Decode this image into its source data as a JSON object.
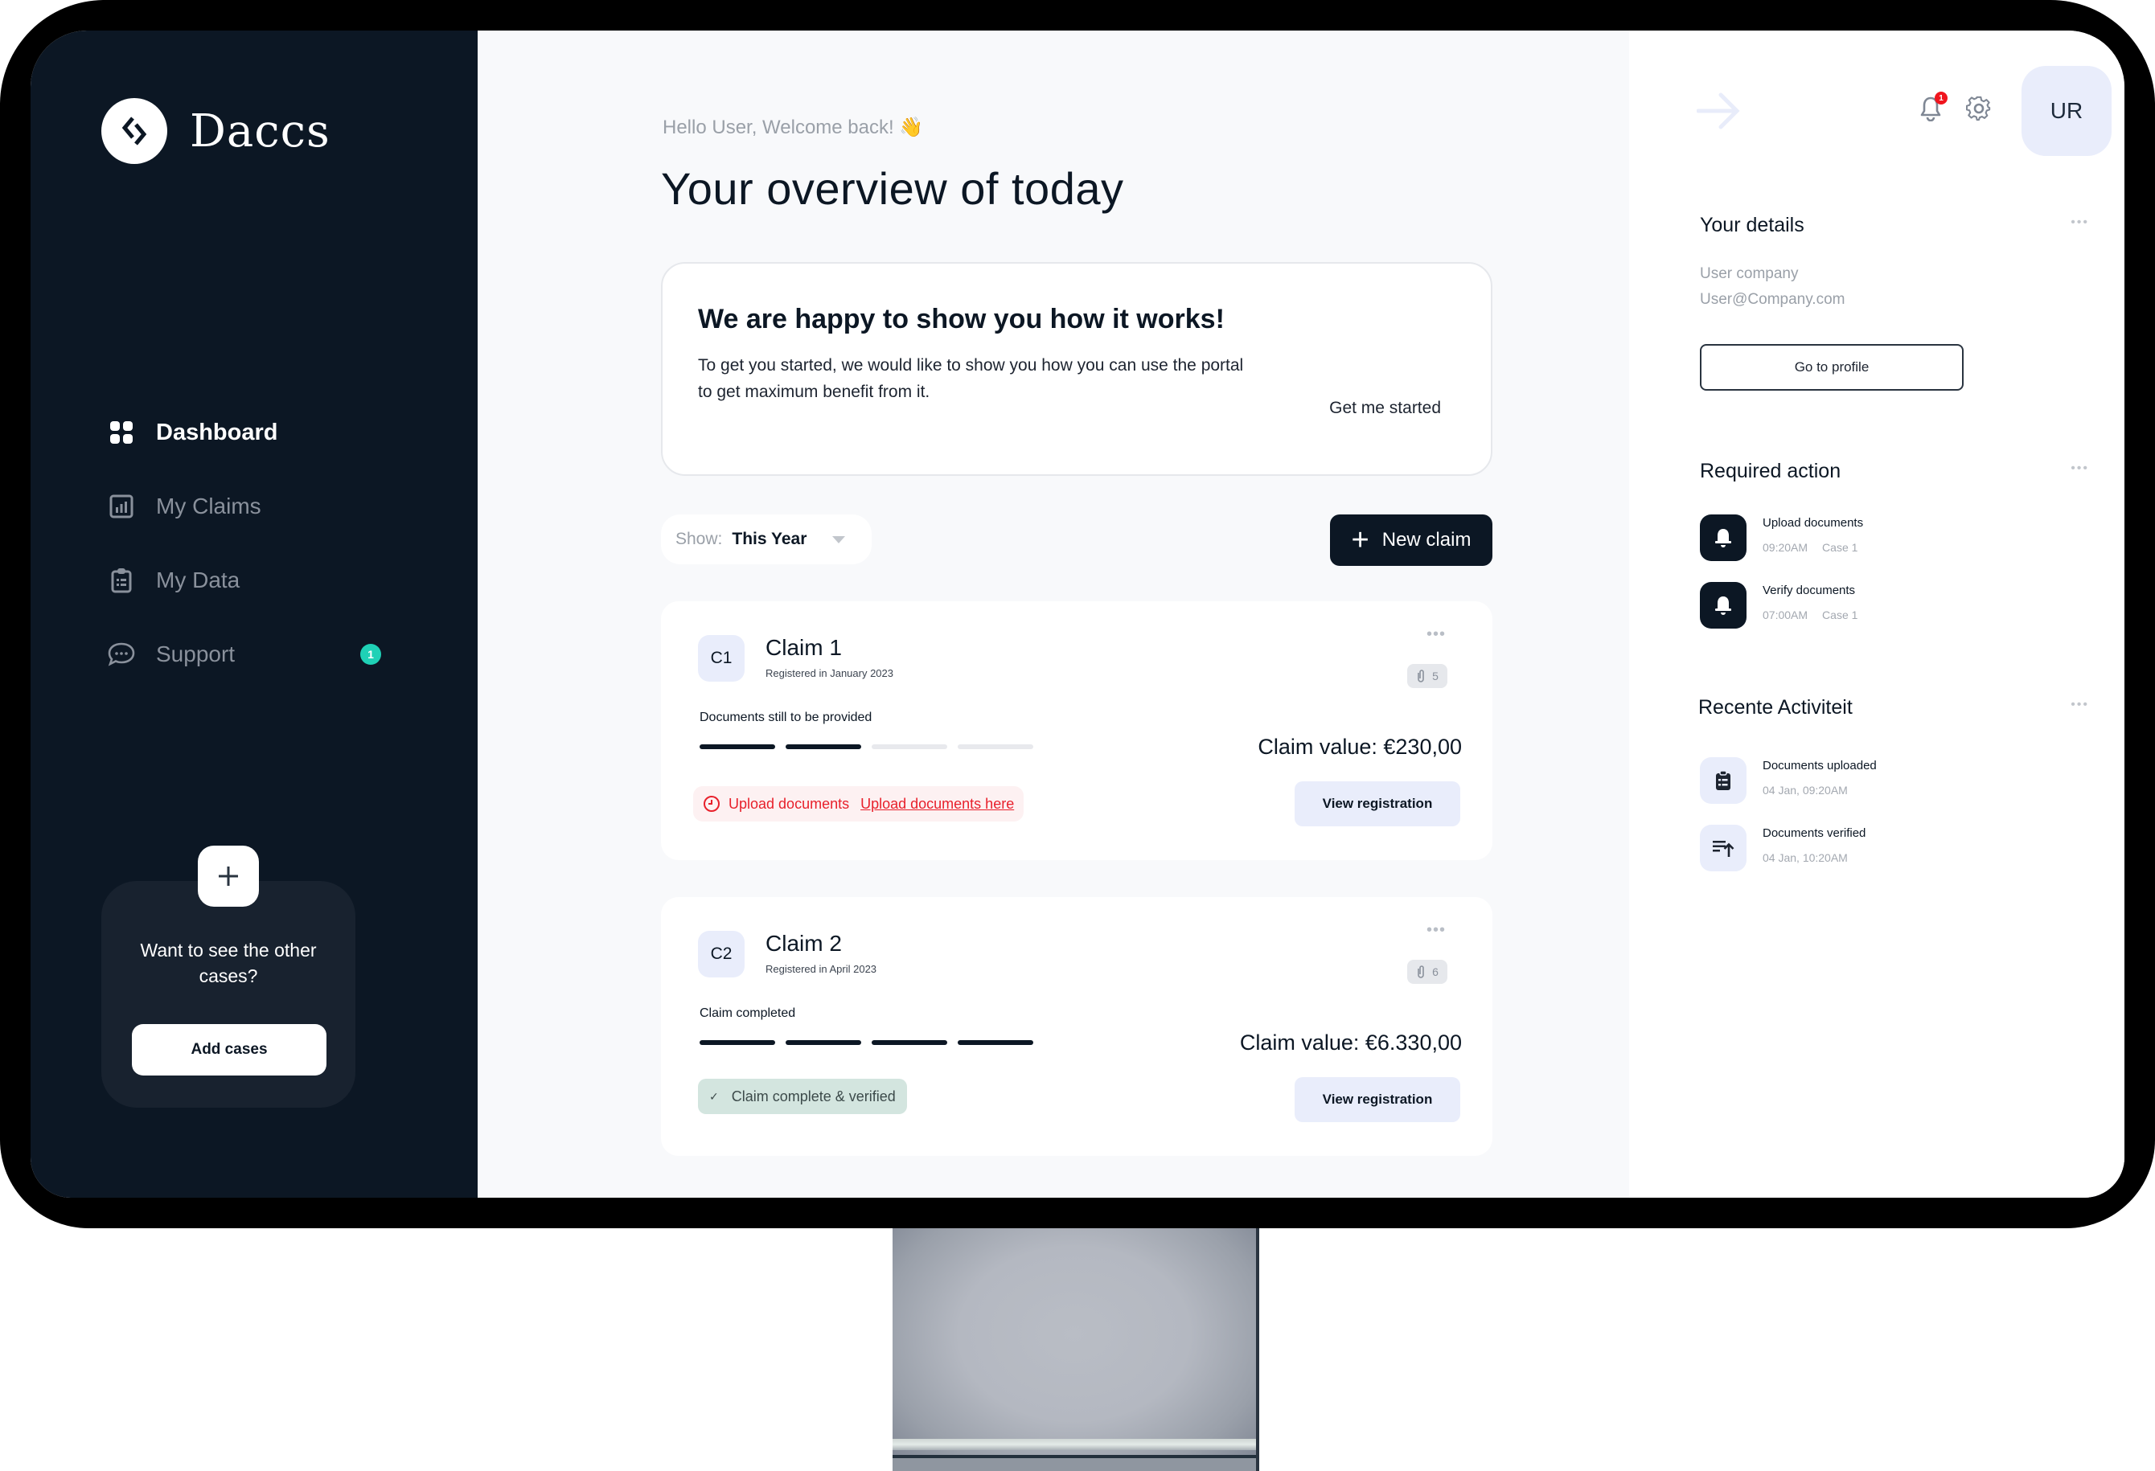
{
  "app": {
    "brand": "Daccs"
  },
  "sidebar": {
    "items": [
      {
        "label": "Dashboard",
        "icon": "grid-icon",
        "active": true
      },
      {
        "label": "My Claims",
        "icon": "bar-chart-icon",
        "active": false
      },
      {
        "label": "My Data",
        "icon": "clipboard-icon",
        "active": false
      },
      {
        "label": "Support",
        "icon": "chat-bubble-icon",
        "active": false,
        "badge": "1"
      }
    ],
    "cases_card": {
      "text": "Want to see the other cases?",
      "button_label": "Add cases"
    }
  },
  "main": {
    "greeting": "Hello User, Welcome back! 👋",
    "title": "Your overview of today",
    "intro": {
      "title": "We are happy to show you how it works!",
      "body": "To get you started, we would like to show you how you can use the portal to get maximum benefit from it.",
      "cta": "Get me started"
    },
    "filter": {
      "label": "Show:",
      "value": "This Year"
    },
    "new_claim_label": "New claim",
    "claims": [
      {
        "badge": "C1",
        "name": "Claim 1",
        "registered": "Registered in January 2023",
        "attachments": "5",
        "status": "Documents still to be provided",
        "progress": {
          "completed": 2,
          "total": 4
        },
        "value": "Claim value: €230,00",
        "view_label": "View registration",
        "alert": {
          "label": "Upload documents",
          "link": "Upload documents here"
        }
      },
      {
        "badge": "C2",
        "name": "Claim 2",
        "registered": "Registered in April 2023",
        "attachments": "6",
        "status": "Claim completed",
        "progress": {
          "completed": 4,
          "total": 4
        },
        "value": "Claim value: €6.330,00",
        "view_label": "View registration",
        "ok": {
          "label": "Claim complete & verified"
        }
      }
    ],
    "more_label": "•••"
  },
  "right": {
    "notifications_badge": "1",
    "avatar_initials": "UR",
    "details": {
      "title": "Your details",
      "company": "User company",
      "email": "User@Company.com",
      "button_label": "Go to profile"
    },
    "required": {
      "title": "Required action",
      "items": [
        {
          "title": "Upload documents",
          "time": "09:20AM",
          "case": "Case 1"
        },
        {
          "title": "Verify documents",
          "time": "07:00AM",
          "case": "Case 1"
        }
      ]
    },
    "activity": {
      "title": "Recente Activiteit",
      "items": [
        {
          "title": "Documents uploaded",
          "time": "04 Jan, 09:20AM",
          "icon": "clipboard-list-icon"
        },
        {
          "title": "Documents verified",
          "time": "04 Jan, 10:20AM",
          "icon": "sort-upload-icon"
        }
      ]
    },
    "more_label": "•••"
  },
  "colors": {
    "sidebar_bg": "#0c1724",
    "accent_dark": "#0c1724",
    "badge_teal": "#1fd1b6",
    "alert_red": "#e8202b",
    "soft_blue": "#e9edfb",
    "success_bg": "#d3e5df"
  }
}
